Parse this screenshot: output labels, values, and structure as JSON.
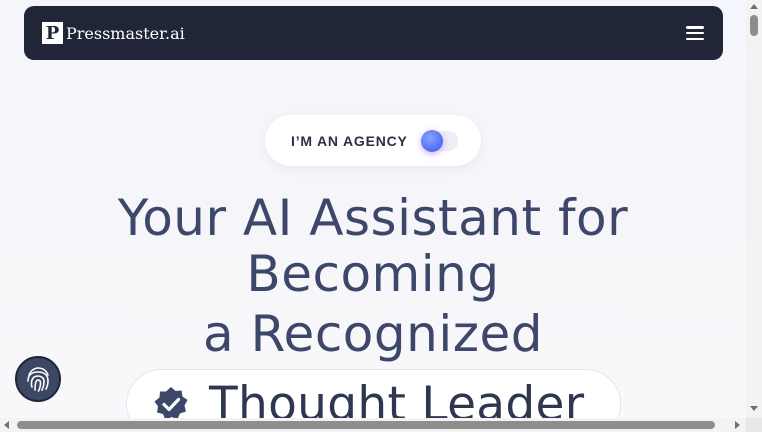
{
  "nav": {
    "logo_letter": "P",
    "brand_name": "Pressmaster.ai",
    "menu_icon": "hamburger-icon"
  },
  "agency_toggle": {
    "label": "I’M AN AGENCY",
    "checked": false
  },
  "hero": {
    "line1": "Your AI Assistant for",
    "line2": "Becoming",
    "line3": "a Recognized",
    "highlight": "Thought Leader",
    "highlight_icon": "verified-badge-icon"
  },
  "floating_button": {
    "icon": "fingerprint-icon"
  },
  "colors": {
    "navbar": "#212538",
    "hero_text": "#3d4769",
    "toggle_knob": "#5a76f5"
  }
}
